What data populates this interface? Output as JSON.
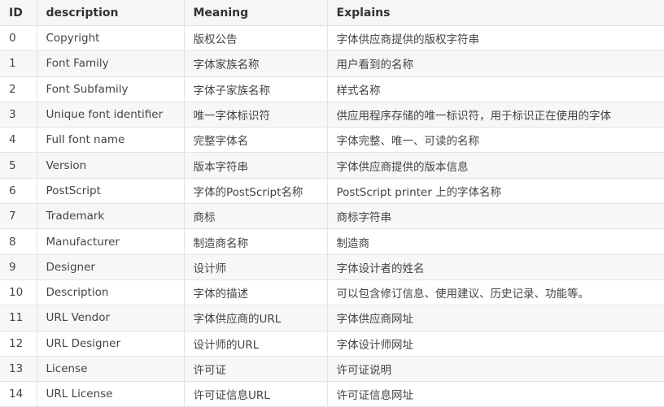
{
  "table": {
    "headers": [
      "ID",
      "description",
      "Meaning",
      "Explains"
    ],
    "rows": [
      {
        "id": "0",
        "description": "Copyright",
        "meaning": "版权公告",
        "explains": "字体供应商提供的版权字符串"
      },
      {
        "id": "1",
        "description": "Font Family",
        "meaning": "字体家族名称",
        "explains": "用户看到的名称"
      },
      {
        "id": "2",
        "description": "Font Subfamily",
        "meaning": "字体子家族名称",
        "explains": "样式名称"
      },
      {
        "id": "3",
        "description": "Unique font identifier",
        "meaning": "唯一字体标识符",
        "explains": "供应用程序存储的唯一标识符，用于标识正在使用的字体"
      },
      {
        "id": "4",
        "description": "Full font name",
        "meaning": "完整字体名",
        "explains": "字体完整、唯一、可读的名称"
      },
      {
        "id": "5",
        "description": "Version",
        "meaning": "版本字符串",
        "explains": "字体供应商提供的版本信息"
      },
      {
        "id": "6",
        "description": "PostScript",
        "meaning": "字体的PostScript名称",
        "explains": "PostScript printer 上的字体名称"
      },
      {
        "id": "7",
        "description": "Trademark",
        "meaning": "商标",
        "explains": "商标字符串"
      },
      {
        "id": "8",
        "description": "Manufacturer",
        "meaning": "制造商名称",
        "explains": "制造商"
      },
      {
        "id": "9",
        "description": "Designer",
        "meaning": "设计师",
        "explains": "字体设计者的姓名"
      },
      {
        "id": "10",
        "description": "Description",
        "meaning": "字体的描述",
        "explains": "可以包含修订信息、使用建议、历史记录、功能等。"
      },
      {
        "id": "11",
        "description": "URL Vendor",
        "meaning": "字体供应商的URL",
        "explains": "字体供应商网址"
      },
      {
        "id": "12",
        "description": "URL Designer",
        "meaning": "设计师的URL",
        "explains": "字体设计师网址"
      },
      {
        "id": "13",
        "description": "License",
        "meaning": "许可证",
        "explains": "许可证说明"
      },
      {
        "id": "14",
        "description": "URL License",
        "meaning": "许可证信息URL",
        "explains": "许可证信息网址"
      }
    ]
  }
}
